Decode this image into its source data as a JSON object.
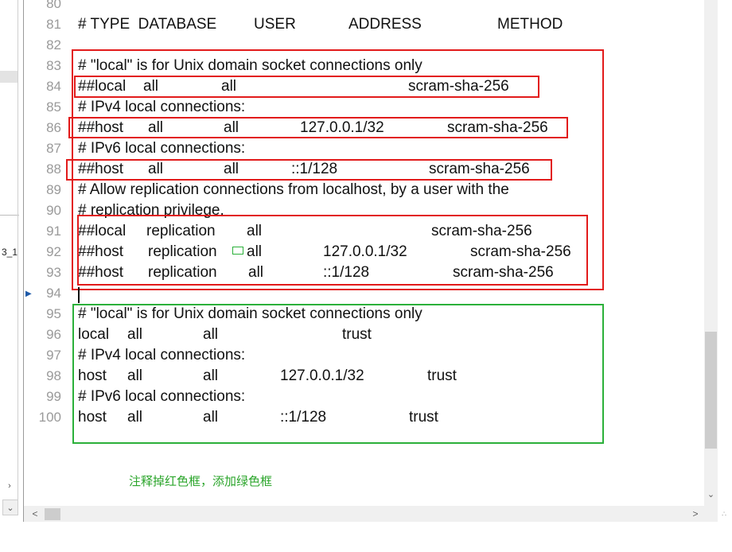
{
  "left_pane": {
    "truncated_text": "3_1"
  },
  "editor": {
    "line_numbers": [
      "80",
      "81",
      "82",
      "83",
      "84",
      "85",
      "86",
      "87",
      "88",
      "89",
      "90",
      "91",
      "92",
      "93",
      "94",
      "95",
      "96",
      "97",
      "98",
      "99",
      "100"
    ],
    "lines": {
      "l81": {
        "a": "# TYPE  DATABASE",
        "b": "USER",
        "c": "ADDRESS",
        "d": "METHOD"
      },
      "l83": {
        "a": "# \"local\" is for Unix domain socket connections only"
      },
      "l84": {
        "a": "##local",
        "b": "all",
        "c": "all",
        "d": "scram-sha-256"
      },
      "l85": {
        "a": "# IPv4 local connections:"
      },
      "l86": {
        "a": "##host",
        "b": "all",
        "c": "all",
        "d": "127.0.0.1/32",
        "e": "scram-sha-256"
      },
      "l87": {
        "a": "# IPv6 local connections:"
      },
      "l88": {
        "a": "##host",
        "b": "all",
        "c": "all",
        "d": "::1/128",
        "e": "scram-sha-256"
      },
      "l89": {
        "a": "# Allow replication connections from localhost, by a user with the"
      },
      "l90": {
        "a": "# replication privilege."
      },
      "l91": {
        "a": "##local",
        "b": "replication",
        "c": "all",
        "d": "scram-sha-256"
      },
      "l92": {
        "a": "##host",
        "b": "replication",
        "c": "all",
        "d": "127.0.0.1/32",
        "e": "scram-sha-256"
      },
      "l93": {
        "a": "##host",
        "b": "replication",
        "c": "all",
        "d": "::1/128",
        "e": "scram-sha-256"
      },
      "l95": {
        "a": "# \"local\" is for Unix domain socket connections only"
      },
      "l96": {
        "a": "local",
        "b": "all",
        "c": "all",
        "d": "trust"
      },
      "l97": {
        "a": "# IPv4 local connections:"
      },
      "l98": {
        "a": "host",
        "b": "all",
        "c": "all",
        "d": "127.0.0.1/32",
        "e": "trust"
      },
      "l99": {
        "a": "# IPv6 local connections:"
      },
      "l100": {
        "a": "host",
        "b": "all",
        "c": "all",
        "d": "::1/128",
        "e": "trust"
      }
    }
  },
  "annotation": {
    "note": "注释掉红色框，添加绿色框"
  },
  "colors": {
    "red_box": "#e21b1b",
    "green_box": "#2bb03a",
    "note_text": "#2ba52b"
  },
  "icons": {
    "scroll_right": "chevron-right-icon",
    "scroll_down": "chevron-down-icon",
    "scroll_left": "chevron-left-icon",
    "line_marker": "triangle-right-icon"
  }
}
